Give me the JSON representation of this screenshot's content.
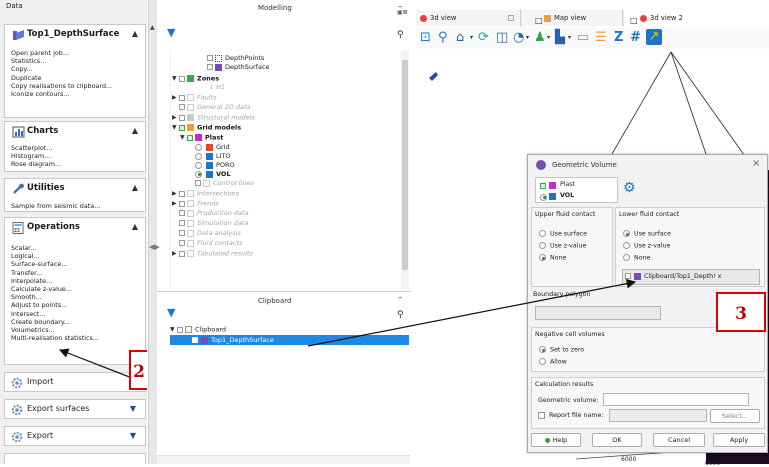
{
  "data_pane": {
    "title": "Data",
    "sections": [
      {
        "title": "Top1_DepthSurface",
        "items": [
          "Open parent job...",
          "Statistics...",
          "Copy...",
          "Duplicate",
          "Copy realisations to clipboard...",
          "Iconize contours..."
        ]
      },
      {
        "title": "Charts",
        "items": [
          "Scatterplot...",
          "Histogram...",
          "Rose diagram..."
        ]
      },
      {
        "title": "Utilities",
        "items": [
          "Sample from seismic data..."
        ]
      },
      {
        "title": "Operations",
        "items": [
          "Scalar...",
          "Logical...",
          "Surface-surface...",
          "Transfer...",
          "Interpolate...",
          "Calculate z-value...",
          "Smooth...",
          "Adjust to points...",
          "Intersect...",
          "Create boundary...",
          "Volumetrics...",
          "Multi-realisation statistics..."
        ]
      }
    ],
    "collapsed": [
      "Import",
      "Export surfaces",
      "Export"
    ]
  },
  "modelling": {
    "title": "Modelling",
    "tree": [
      "DepthPoints",
      "DepthSurface",
      "Zones",
      "H1",
      "Faults",
      "General 2D data",
      "Structural models",
      "Grid models",
      "Plast",
      "Grid",
      "LITO",
      "PORO",
      "VOL",
      "Control lines",
      "Intersections",
      "Trends",
      "Production data",
      "Simulation data",
      "Data analysis",
      "Fluid contacts",
      "Tabulated results"
    ]
  },
  "clipboard": {
    "title": "Clipboard",
    "root": "Clipboard",
    "item": "Top1_DepthSurface"
  },
  "views": {
    "tabs": [
      "3d view",
      "Map view",
      "3d view 2"
    ]
  },
  "dialog": {
    "title": "Geometric Volume",
    "grid": "Plast",
    "param": "VOL",
    "upper_title": "Upper fluid contact",
    "lower_title": "Lower fluid contact",
    "opt_surface": "Use surface",
    "opt_zvalue": "Use z-value",
    "opt_none": "None",
    "surface_ref": "Clipboard/Top1_Depth! x",
    "boundary_label": "Boundary polygon",
    "neg_title": "Negative cell volumes",
    "set_zero": "Set to zero",
    "allow": "Allow",
    "calc_title": "Calculation results",
    "geo_volume_label": "Geometric volume:",
    "report_label": "Report file name:",
    "select_btn": "Select...",
    "help_btn": "Help",
    "ok_btn": "OK",
    "cancel_btn": "Cancel",
    "apply_btn": "Apply"
  },
  "annotations": {
    "label2": "2",
    "label3": "3"
  },
  "axis_labels": [
    "6000",
    "6000"
  ],
  "colors": {
    "accent": "#1c73c7",
    "selection": "#1e88e5",
    "red": "#e00000"
  }
}
